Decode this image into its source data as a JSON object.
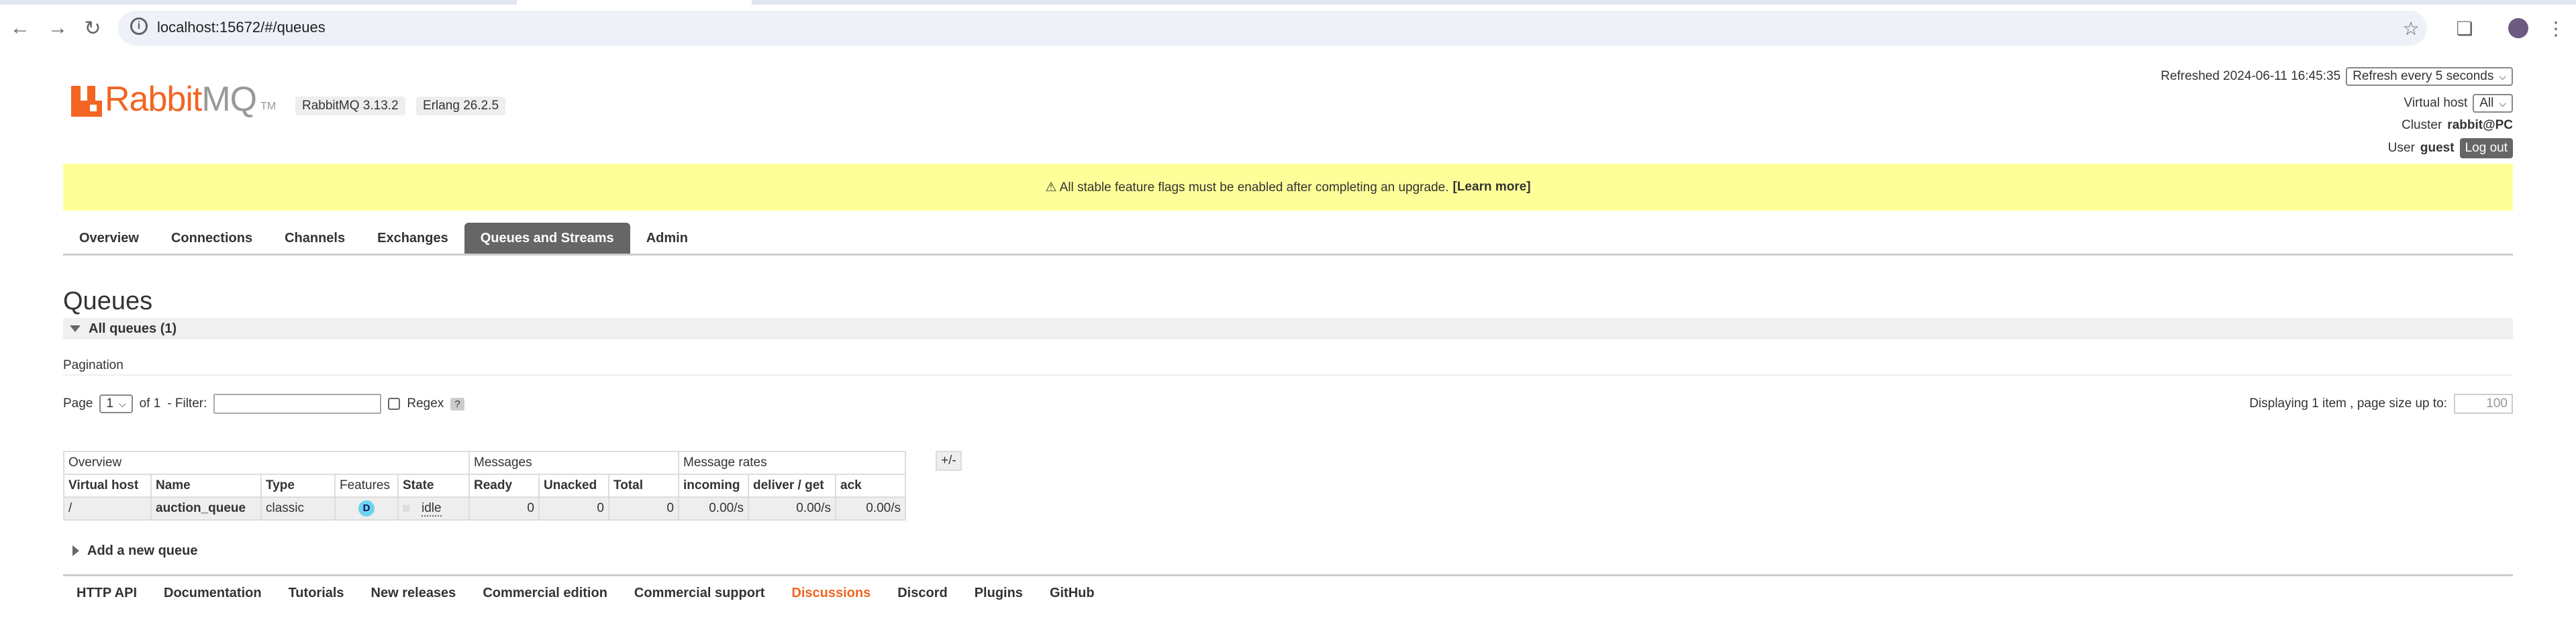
{
  "browser": {
    "url": "localhost:15672/#/queues"
  },
  "header": {
    "logo_word": "Rabbit",
    "logo_suffix": "MQ",
    "logo_tm": "TM",
    "rabbitmq_version": "RabbitMQ 3.13.2",
    "erlang_version": "Erlang 26.2.5",
    "refreshed_label": "Refreshed 2024-06-11 16:45:35",
    "refresh_select": "Refresh every 5 seconds",
    "vhost_label": "Virtual host",
    "vhost_select": "All",
    "cluster_label": "Cluster",
    "cluster_value": "rabbit@PC",
    "user_label": "User",
    "user_value": "guest",
    "logout_label": "Log out"
  },
  "banner": {
    "text": "⚠ All stable feature flags must be enabled after completing an upgrade.",
    "link": "[Learn more]"
  },
  "tabs": [
    {
      "label": "Overview"
    },
    {
      "label": "Connections"
    },
    {
      "label": "Channels"
    },
    {
      "label": "Exchanges"
    },
    {
      "label": "Queues and Streams",
      "active": true
    },
    {
      "label": "Admin"
    }
  ],
  "main": {
    "title": "Queues",
    "section_label": "All queues (1)",
    "pagination_label": "Pagination",
    "page_label": "Page",
    "page_value": "1",
    "of_label": "of 1",
    "filter_label": "- Filter:",
    "filter_value": "",
    "regex_label": "Regex",
    "help_label": "?",
    "display_text": "Displaying 1 item , page size up to:",
    "page_size": "100",
    "add_new_label": "Add a new queue"
  },
  "table": {
    "toggle": "+/-",
    "groups": [
      "Overview",
      "Messages",
      "Message rates"
    ],
    "columns": [
      "Virtual host",
      "Name",
      "Type",
      "Features",
      "State",
      "Ready",
      "Unacked",
      "Total",
      "incoming",
      "deliver / get",
      "ack"
    ],
    "rows": [
      {
        "vhost": "/",
        "name": "auction_queue",
        "type": "classic",
        "features": "D",
        "state": "idle",
        "ready": "0",
        "unacked": "0",
        "total": "0",
        "incoming": "0.00/s",
        "deliver_get": "0.00/s",
        "ack": "0.00/s"
      }
    ]
  },
  "footer": {
    "links": [
      "HTTP API",
      "Documentation",
      "Tutorials",
      "New releases",
      "Commercial edition",
      "Commercial support",
      "Discussions",
      "Discord",
      "Plugins",
      "GitHub"
    ]
  }
}
